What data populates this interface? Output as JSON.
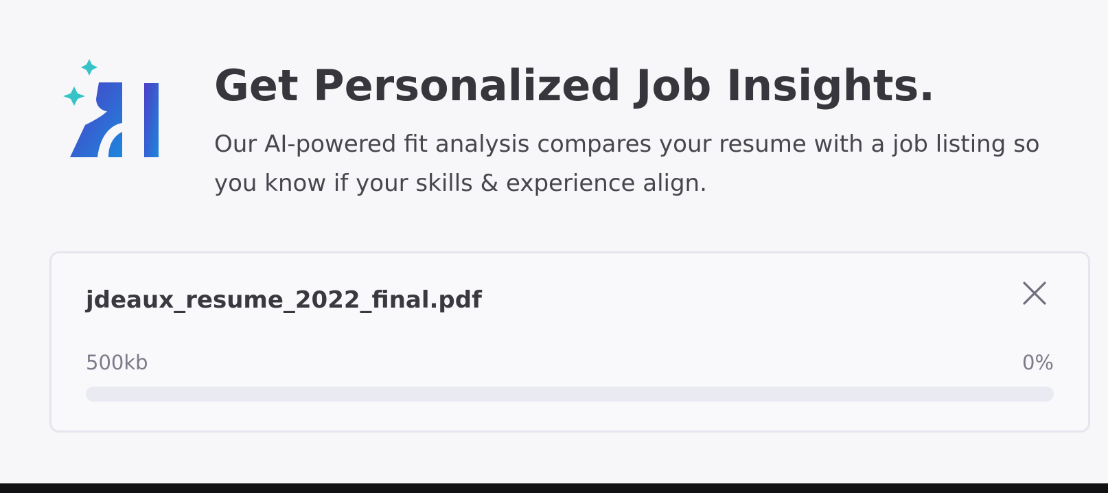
{
  "hero": {
    "logo_text": "AI",
    "title": "Get Personalized Job Insights.",
    "description": "Our AI-powered fit analysis compares your resume with a job listing so you know if your skills & experience align."
  },
  "upload": {
    "file_name": "jdeaux_resume_2022_final.pdf",
    "file_size": "500kb",
    "progress_label": "0%",
    "progress_fraction": 0,
    "close_icon": "close-icon"
  },
  "colors": {
    "title": "#37363d",
    "body_text": "#47464e",
    "muted_text": "#7c7b8a",
    "logo_sparkle": "#35c3c8",
    "logo_gradient_start": "#4d3ec6",
    "logo_gradient_end": "#1d86dc",
    "progress_track": "#eaeaf3"
  }
}
